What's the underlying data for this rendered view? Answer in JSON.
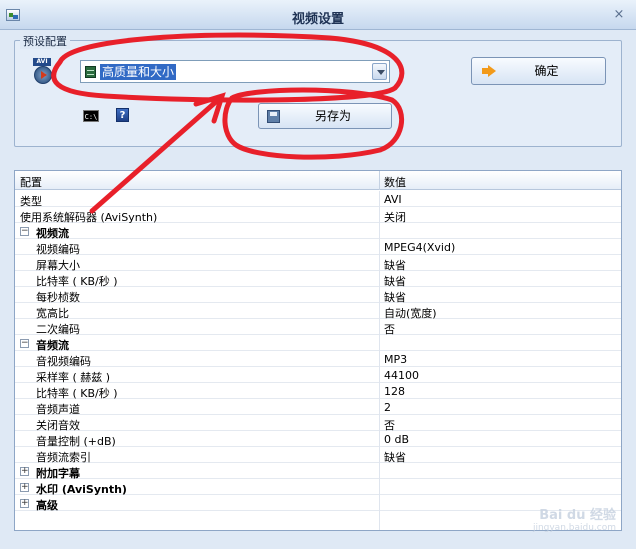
{
  "window": {
    "title": "视频设置",
    "close_glyph": "×"
  },
  "preset": {
    "legend": "预设配置",
    "avi_tag": "AVI",
    "selected_value": "高质量和大小",
    "ok_label": "确定",
    "save_as_label": "另存为",
    "cmd_label": "C:\\",
    "help_label": "?"
  },
  "grid": {
    "headers": {
      "key": "配置",
      "value": "数值"
    },
    "rows": [
      {
        "k": "类型",
        "v": "AVI"
      },
      {
        "k": "使用系统解码器 (AviSynth)",
        "v": "关闭"
      }
    ],
    "sections": [
      {
        "label": "视频流",
        "expander": "−",
        "rows": [
          {
            "k": "视频编码",
            "v": "MPEG4(Xvid)"
          },
          {
            "k": "屏幕大小",
            "v": "缺省"
          },
          {
            "k": "比特率 ( KB/秒 )",
            "v": "缺省"
          },
          {
            "k": "每秒桢数",
            "v": "缺省"
          },
          {
            "k": "宽高比",
            "v": "自动(宽度)"
          },
          {
            "k": "二次编码",
            "v": "否"
          }
        ]
      },
      {
        "label": "音频流",
        "expander": "−",
        "rows": [
          {
            "k": "音视频编码",
            "v": "MP3"
          },
          {
            "k": "采样率 ( 赫兹 )",
            "v": "44100"
          },
          {
            "k": "比特率 ( KB/秒 )",
            "v": "128"
          },
          {
            "k": "音频声道",
            "v": "2"
          },
          {
            "k": "关闭音效",
            "v": "否"
          },
          {
            "k": "音量控制 (+dB)",
            "v": "0 dB"
          },
          {
            "k": "音频流索引",
            "v": "缺省"
          }
        ]
      }
    ],
    "collapsed": [
      {
        "label": "附加字幕",
        "expander": "+"
      },
      {
        "label": "水印 (AviSynth)",
        "expander": "+"
      },
      {
        "label": "高级",
        "expander": "+"
      }
    ]
  },
  "watermark": {
    "brand": "Bai du 经验",
    "url": "jingyan.baidu.com"
  },
  "colors": {
    "annotation": "#e8202a",
    "selection": "#316ac5"
  }
}
